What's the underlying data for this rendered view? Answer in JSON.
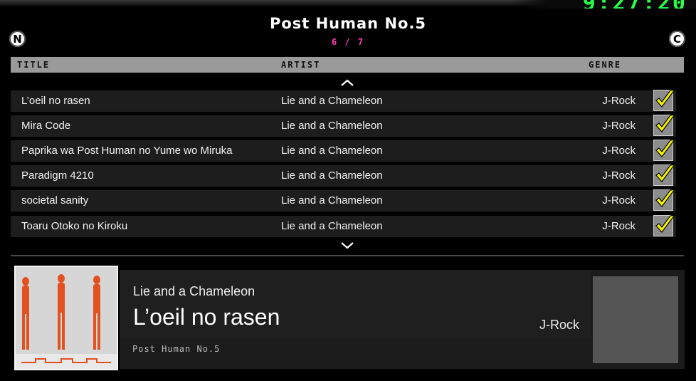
{
  "top_deco_text": "9:27:20",
  "album": {
    "title": "Post Human No.5",
    "page": "6 / 7"
  },
  "buttons": {
    "left_label": "N",
    "right_label": "C"
  },
  "columns": {
    "title": "TITLE",
    "artist": "ARTIST",
    "genre": "GENRE"
  },
  "tracks": [
    {
      "title": "L’oeil no rasen",
      "artist": "Lie and a Chameleon",
      "genre": "J-Rock",
      "checked": true
    },
    {
      "title": "Mira Code",
      "artist": "Lie and a Chameleon",
      "genre": "J-Rock",
      "checked": true
    },
    {
      "title": "Paprika wa Post Human no Yume wo Miruka",
      "artist": "Lie and a Chameleon",
      "genre": "J-Rock",
      "checked": true
    },
    {
      "title": "Paradigm 4210",
      "artist": "Lie and a Chameleon",
      "genre": "J-Rock",
      "checked": true
    },
    {
      "title": "societal sanity",
      "artist": "Lie and a Chameleon",
      "genre": "J-Rock",
      "checked": true
    },
    {
      "title": "Toaru Otoko no Kiroku",
      "artist": "Lie and a Chameleon",
      "genre": "J-Rock",
      "checked": true
    }
  ],
  "selected": {
    "artist": "Lie and a Chameleon",
    "title": "L’oeil no rasen",
    "genre": "J-Rock",
    "album": "Post Human No.5"
  },
  "colors": {
    "accent": "#ff3fb6",
    "check": "#f4f400",
    "header": "#9a9a9a"
  }
}
